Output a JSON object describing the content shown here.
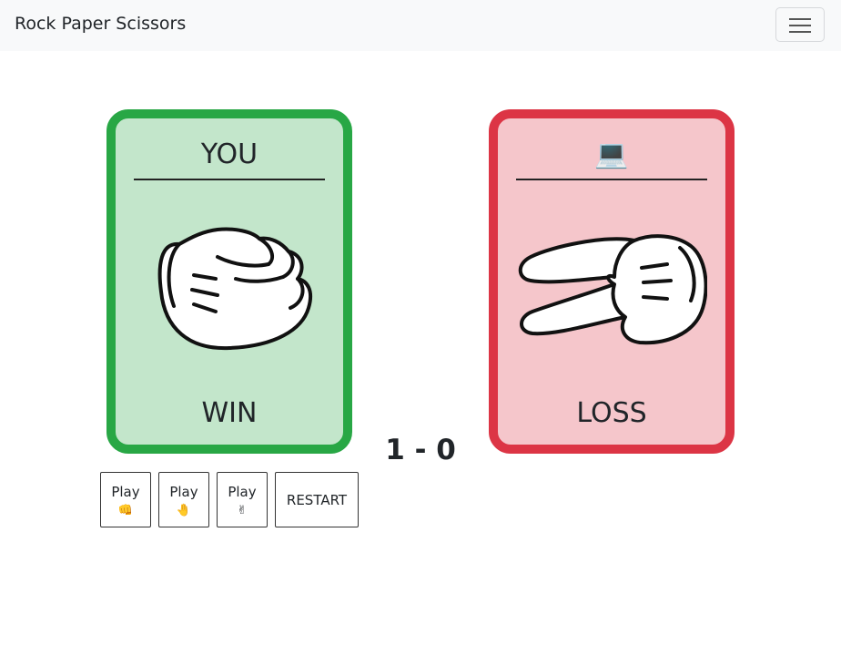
{
  "navbar": {
    "brand": "Rock Paper Scissors",
    "menu_icon": "hamburger-menu-icon"
  },
  "player_card": {
    "title": "YOU",
    "hand": "rock",
    "hand_icon": "rock-fist-icon",
    "result": "WIN",
    "border_color": "#28a745",
    "bg_color": "#c3e6cb"
  },
  "computer_card": {
    "title": "💻",
    "title_icon": "laptop-icon",
    "hand": "scissors",
    "hand_icon": "scissors-hand-icon",
    "result": "LOSS",
    "border_color": "#dc3545",
    "bg_color": "#f5c6cb"
  },
  "score": {
    "display": "1 - 0",
    "player": 1,
    "computer": 0
  },
  "buttons": {
    "rock": {
      "label": "Play",
      "emoji": "👊"
    },
    "paper": {
      "label": "Play",
      "emoji": "🤚"
    },
    "scissors": {
      "label": "Play",
      "emoji": "✌"
    },
    "restart": {
      "label": "RESTART"
    }
  }
}
